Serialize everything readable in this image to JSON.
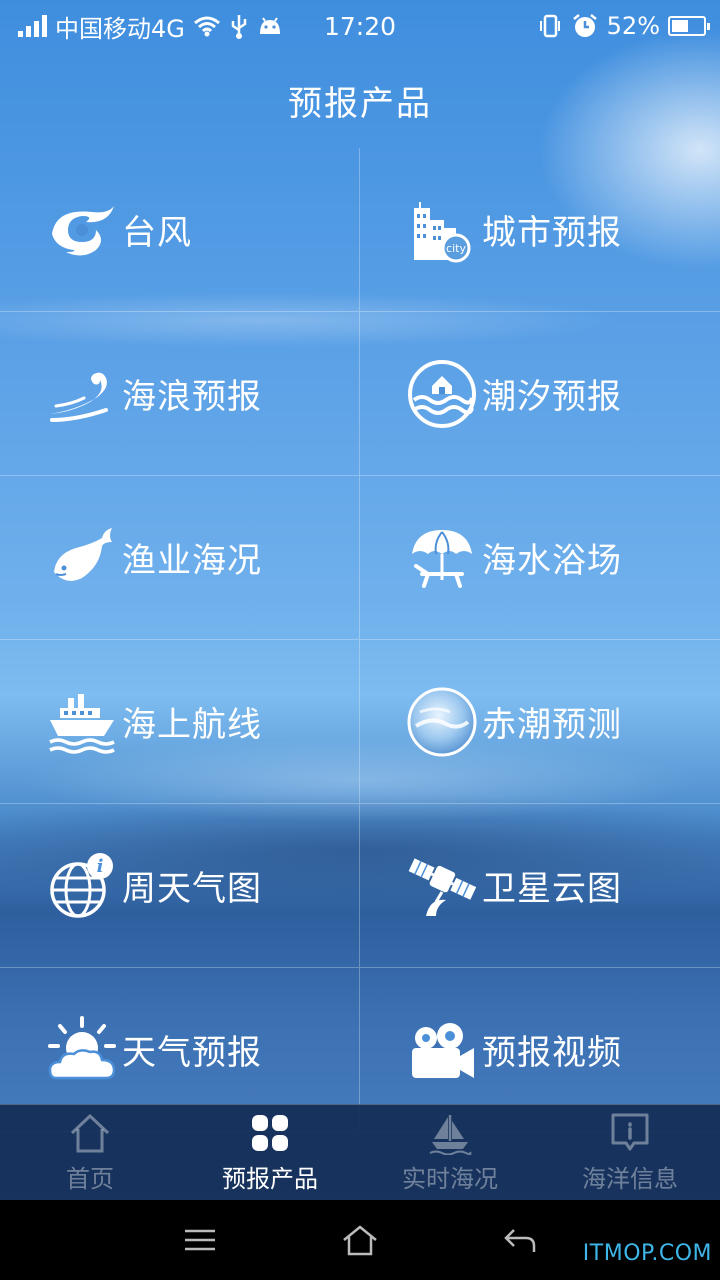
{
  "status_bar": {
    "carrier": "中国移动4G",
    "time": "17:20",
    "battery": "52%",
    "battery_level": 0.52
  },
  "header": {
    "title": "预报产品"
  },
  "grid": [
    {
      "label": "台风",
      "icon": "typhoon-icon"
    },
    {
      "label": "城市预报",
      "icon": "city-icon"
    },
    {
      "label": "海浪预报",
      "icon": "wave-icon"
    },
    {
      "label": "潮汐预报",
      "icon": "tide-icon"
    },
    {
      "label": "渔业海况",
      "icon": "fish-icon"
    },
    {
      "label": "海水浴场",
      "icon": "beach-umbrella-icon"
    },
    {
      "label": "海上航线",
      "icon": "ship-icon"
    },
    {
      "label": "赤潮预测",
      "icon": "red-tide-icon"
    },
    {
      "label": "周天气图",
      "icon": "globe-info-icon"
    },
    {
      "label": "卫星云图",
      "icon": "satellite-icon"
    },
    {
      "label": "天气预报",
      "icon": "sun-cloud-icon"
    },
    {
      "label": "预报视频",
      "icon": "video-camera-icon"
    }
  ],
  "bottom_nav": [
    {
      "label": "首页",
      "icon": "home-icon",
      "active": false
    },
    {
      "label": "预报产品",
      "icon": "grid-icon",
      "active": true
    },
    {
      "label": "实时海况",
      "icon": "sailboat-icon",
      "active": false
    },
    {
      "label": "海洋信息",
      "icon": "info-bubble-icon",
      "active": false
    }
  ],
  "watermark": "ITMOP.COM",
  "colors": {
    "accent": "#3fb6e8",
    "nav_bg": "#142d55"
  }
}
